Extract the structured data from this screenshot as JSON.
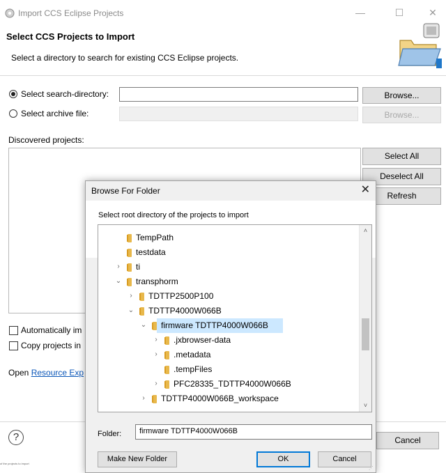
{
  "window": {
    "title": "Import CCS Eclipse Projects",
    "minimize_glyph": "—",
    "maximize_glyph": "☐",
    "close_glyph": "✕"
  },
  "header": {
    "title": "Select CCS Projects to Import",
    "description": "Select a directory to search for existing CCS Eclipse projects."
  },
  "source": {
    "search_dir_label": "Select search-directory:",
    "search_dir_value": "",
    "archive_label": "Select archive file:",
    "archive_value": "",
    "browse_label": "Browse...",
    "browse_archive_label": "Browse...",
    "selected": "search-directory"
  },
  "projects": {
    "label": "Discovered projects:",
    "select_all": "Select All",
    "deselect_all": "Deselect All",
    "refresh": "Refresh"
  },
  "options": {
    "auto_import_label": "Automatically im",
    "copy_label": "Copy projects in",
    "open_prefix": "Open ",
    "open_link": "Resource Exp"
  },
  "footer": {
    "help_glyph": "?",
    "cancel_label": "Cancel",
    "status_text": "of the projects to import"
  },
  "dialog": {
    "title": "Browse For Folder",
    "close_glyph": "✕",
    "description": "Select root directory of the projects to import",
    "tree": [
      {
        "label": "TempPath",
        "twisty": "",
        "depth": 0,
        "selected": false
      },
      {
        "label": "testdata",
        "twisty": "",
        "depth": 0,
        "selected": false
      },
      {
        "label": "ti",
        "twisty": "›",
        "depth": 0,
        "selected": false
      },
      {
        "label": "transphorm",
        "twisty": "⌄",
        "depth": 0,
        "selected": false
      },
      {
        "label": "TDTTP2500P100",
        "twisty": "›",
        "depth": 1,
        "selected": false
      },
      {
        "label": "TDTTP4000W066B",
        "twisty": "⌄",
        "depth": 1,
        "selected": false
      },
      {
        "label": "firmware TDTTP4000W066B",
        "twisty": "⌄",
        "depth": 2,
        "selected": true
      },
      {
        "label": ".jxbrowser-data",
        "twisty": "›",
        "depth": 3,
        "selected": false
      },
      {
        "label": ".metadata",
        "twisty": "›",
        "depth": 3,
        "selected": false
      },
      {
        "label": ".tempFiles",
        "twisty": "",
        "depth": 3,
        "selected": false
      },
      {
        "label": "PFC28335_TDTTP4000W066B",
        "twisty": "›",
        "depth": 3,
        "selected": false
      },
      {
        "label": "TDTTP4000W066B_workspace",
        "twisty": "›",
        "depth": 2,
        "selected": false
      }
    ],
    "scroll_up_glyph": "˄",
    "scroll_down_glyph": "˅",
    "folder_label": "Folder:",
    "folder_value": "firmware TDTTP4000W066B",
    "make_new_folder": "Make New Folder",
    "ok": "OK",
    "cancel": "Cancel"
  },
  "colors": {
    "selection": "#cce8ff",
    "folder": "#e8b84b",
    "link": "#0a56b8",
    "accent": "#0078d7"
  }
}
